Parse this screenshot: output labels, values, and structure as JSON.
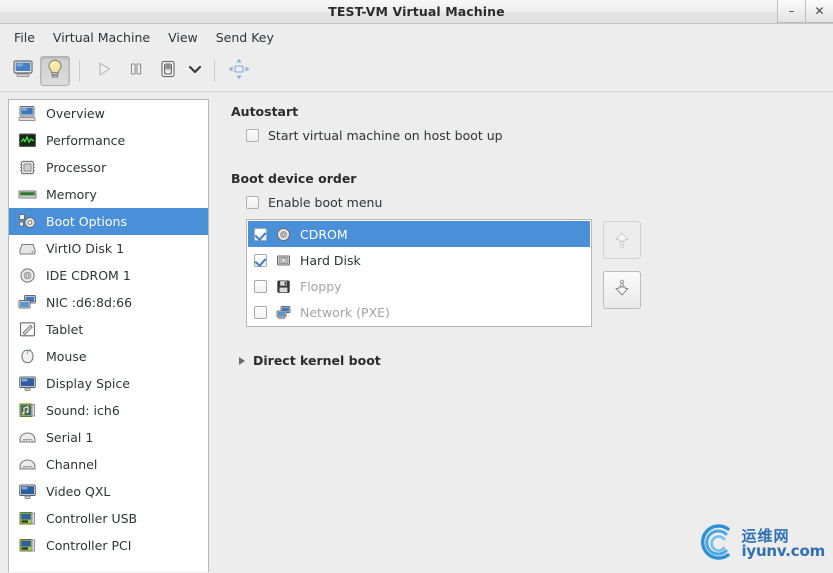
{
  "window": {
    "title": "TEST-VM Virtual Machine",
    "buttons": [
      {
        "name": "minimize-button",
        "glyph": "–"
      },
      {
        "name": "close-button",
        "glyph": "✕"
      }
    ]
  },
  "menubar": {
    "items": [
      {
        "label": "File"
      },
      {
        "label": "Virtual Machine"
      },
      {
        "label": "View"
      },
      {
        "label": "Send Key"
      }
    ]
  },
  "toolbar": {
    "items": [
      {
        "name": "show-console-button",
        "icon": "monitor-icon",
        "pressed": false,
        "enabled": true
      },
      {
        "name": "show-details-button",
        "icon": "lightbulb-icon",
        "pressed": true,
        "enabled": true
      },
      {
        "name": "separator-1",
        "icon": "separator",
        "pressed": false,
        "enabled": true
      },
      {
        "name": "run-button",
        "icon": "play-icon",
        "pressed": false,
        "enabled": false
      },
      {
        "name": "pause-button",
        "icon": "pause-icon",
        "pressed": false,
        "enabled": true
      },
      {
        "name": "shutdown-button",
        "icon": "power-icon",
        "pressed": false,
        "enabled": true
      },
      {
        "name": "shutdown-menu-button",
        "icon": "chevron-down-icon",
        "pressed": false,
        "enabled": true
      },
      {
        "name": "separator-2",
        "icon": "separator",
        "pressed": false,
        "enabled": true
      },
      {
        "name": "fullscreen-button",
        "icon": "resize-arrows-icon",
        "pressed": false,
        "enabled": true
      }
    ]
  },
  "sidebar": {
    "items": [
      {
        "label": "Overview",
        "icon": "computer-icon",
        "selected": false
      },
      {
        "label": "Performance",
        "icon": "graph-icon",
        "selected": false
      },
      {
        "label": "Processor",
        "icon": "cpu-icon",
        "selected": false
      },
      {
        "label": "Memory",
        "icon": "ram-icon",
        "selected": false
      },
      {
        "label": "Boot Options",
        "icon": "boot-gear-icon",
        "selected": true
      },
      {
        "label": "VirtIO Disk 1",
        "icon": "harddisk-icon",
        "selected": false
      },
      {
        "label": "IDE CDROM 1",
        "icon": "cdrom-icon",
        "selected": false
      },
      {
        "label": "NIC :d6:8d:66",
        "icon": "network-icon",
        "selected": false
      },
      {
        "label": "Tablet",
        "icon": "tablet-icon",
        "selected": false
      },
      {
        "label": "Mouse",
        "icon": "mouse-icon",
        "selected": false
      },
      {
        "label": "Display Spice",
        "icon": "display-icon",
        "selected": false
      },
      {
        "label": "Sound: ich6",
        "icon": "sound-card-icon",
        "selected": false
      },
      {
        "label": "Serial 1",
        "icon": "serial-icon",
        "selected": false
      },
      {
        "label": "Channel",
        "icon": "channel-icon",
        "selected": false
      },
      {
        "label": "Video QXL",
        "icon": "video-icon",
        "selected": false
      },
      {
        "label": "Controller USB",
        "icon": "controller-card-icon",
        "selected": false
      },
      {
        "label": "Controller PCI",
        "icon": "controller-card-icon",
        "selected": false
      }
    ]
  },
  "content": {
    "autostart": {
      "heading": "Autostart",
      "checkbox_label": "Start virtual machine on host boot up",
      "checked": false
    },
    "boot_order": {
      "heading": "Boot device order",
      "enable_menu_label": "Enable boot menu",
      "enable_menu_checked": false,
      "devices": [
        {
          "label": "CDROM",
          "icon": "cdrom-icon",
          "checked": true,
          "selected": true,
          "enabled": true
        },
        {
          "label": "Hard Disk",
          "icon": "harddisk-icon",
          "checked": true,
          "selected": false,
          "enabled": true
        },
        {
          "label": "Floppy",
          "icon": "floppy-icon",
          "checked": false,
          "selected": false,
          "enabled": false
        },
        {
          "label": "Network (PXE)",
          "icon": "network-icon",
          "checked": false,
          "selected": false,
          "enabled": false
        }
      ],
      "move_up_button": "move-up",
      "move_down_button": "move-down",
      "move_up_enabled": false,
      "move_down_enabled": true
    },
    "direct_kernel_boot": {
      "label": "Direct kernel boot",
      "expanded": false
    }
  },
  "watermark": {
    "cn_text": "运维网",
    "en_text": "iyunv.com"
  },
  "colors": {
    "selection_blue": "#4a90d9",
    "window_bg": "#ededed",
    "list_bg": "#ffffff",
    "text": "#2e3436",
    "disabled_text": "#a3a3a3",
    "watermark_blue": "#2f6fb5"
  }
}
